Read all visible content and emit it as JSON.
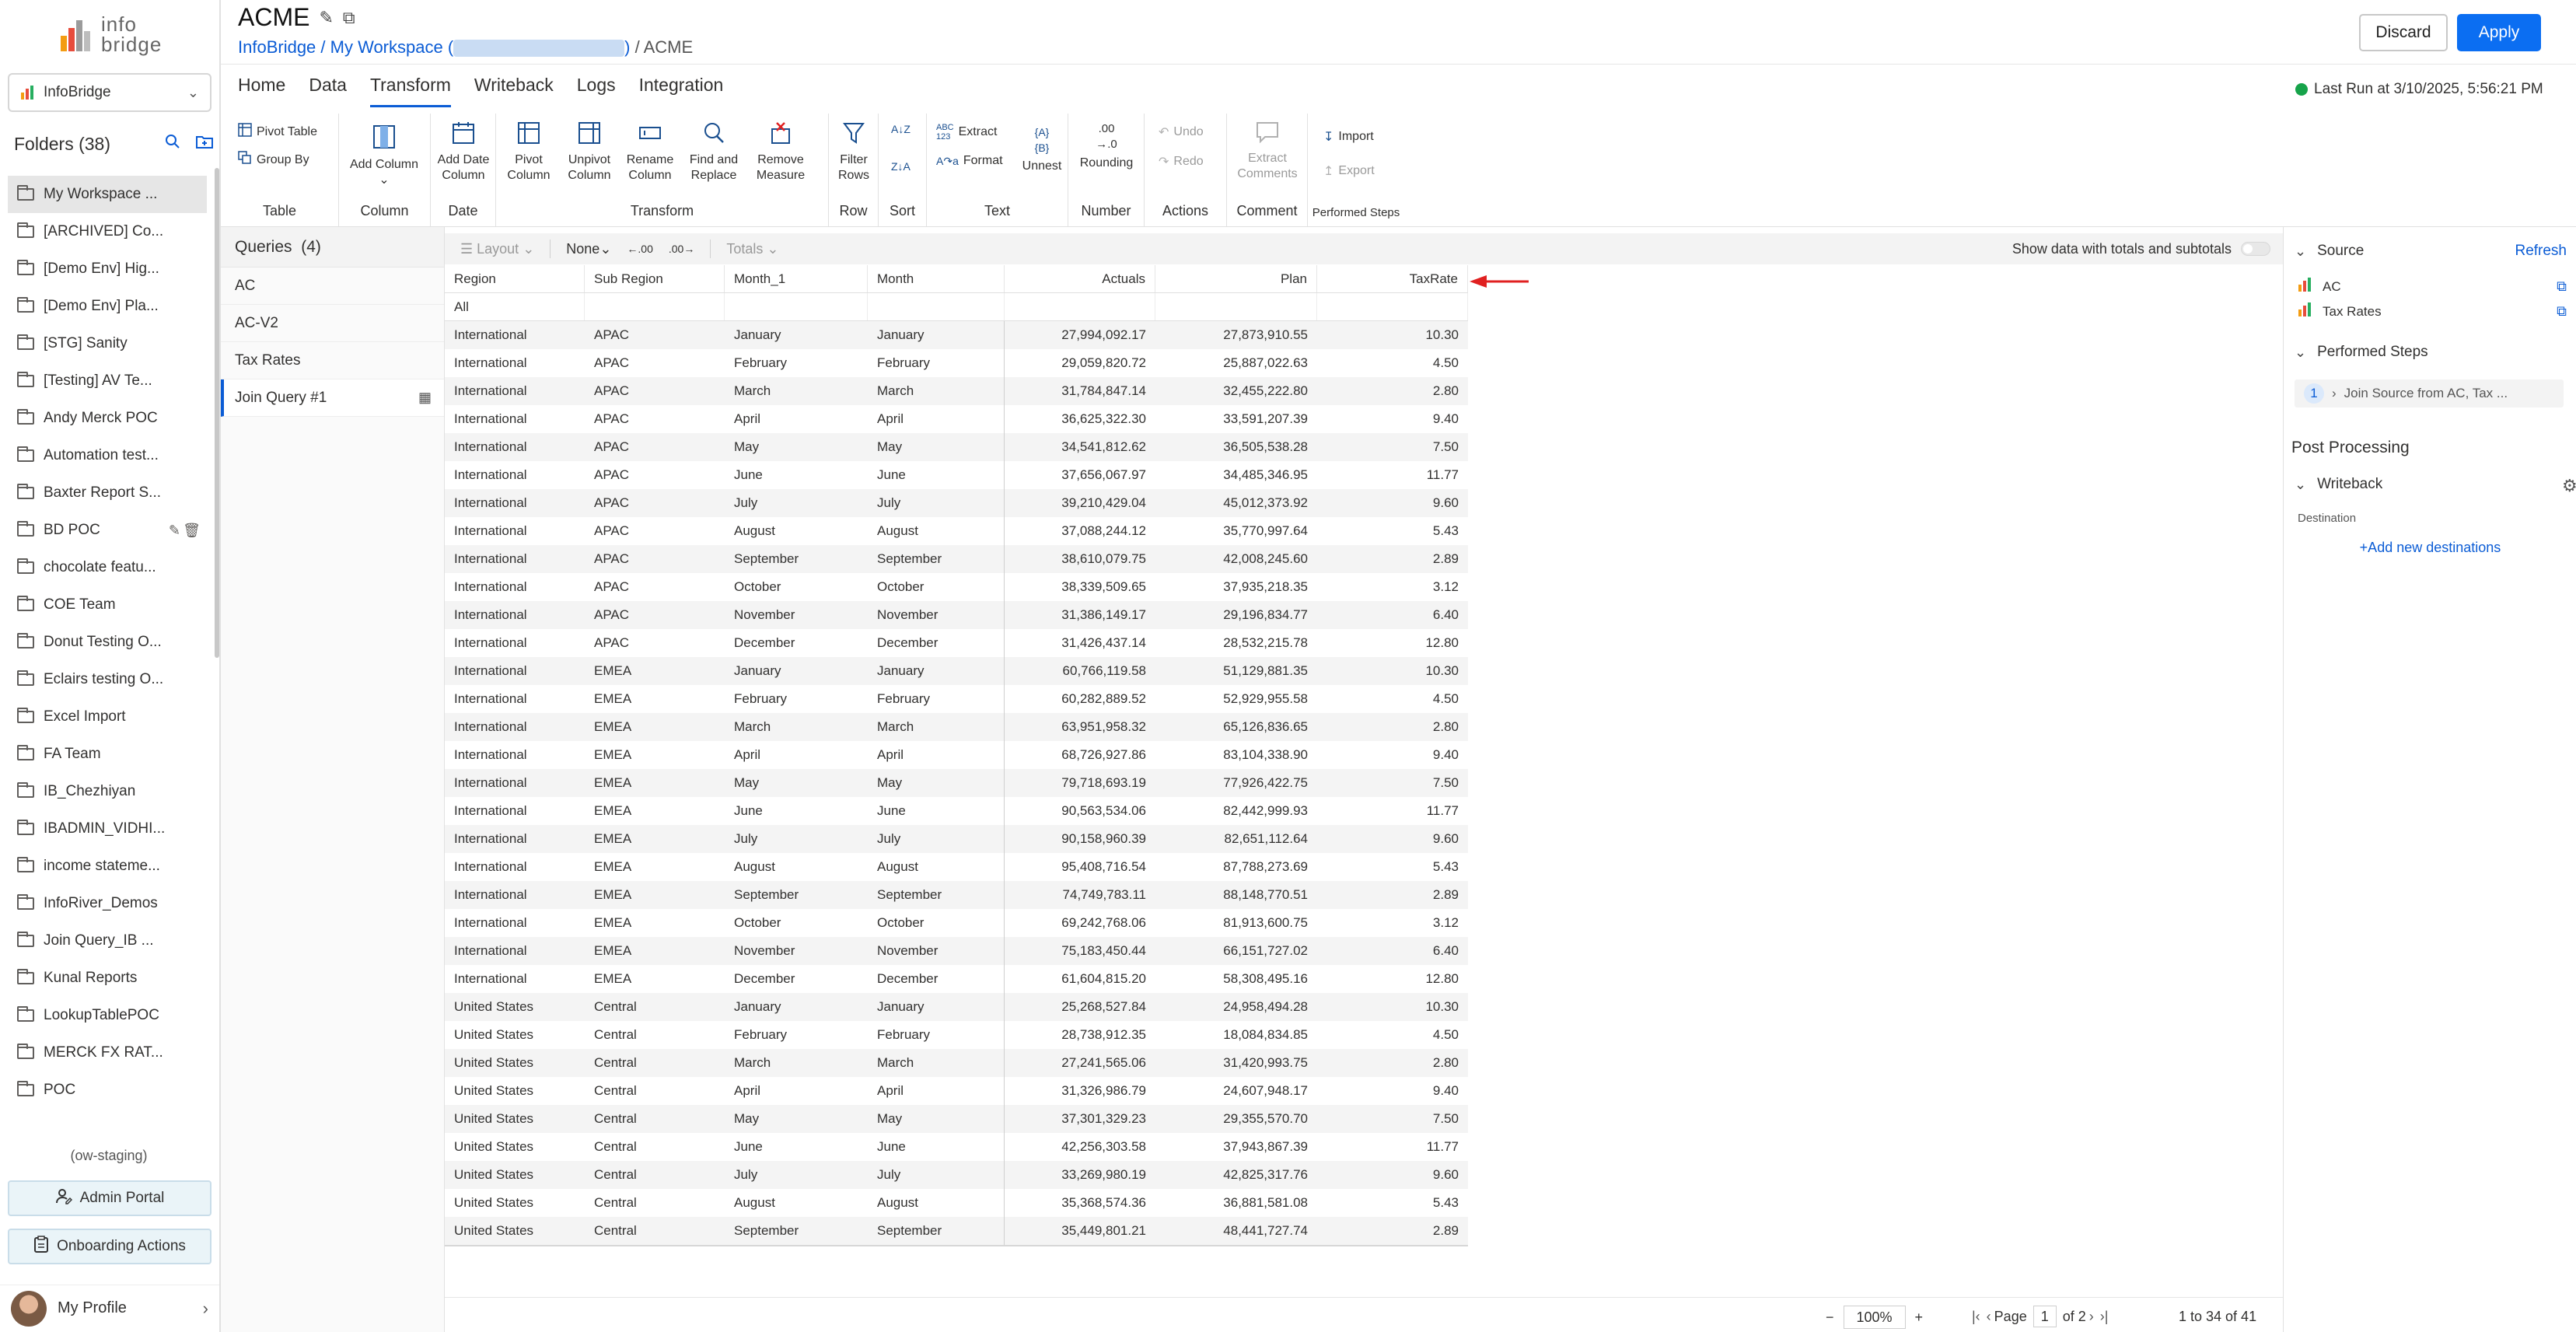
{
  "app": {
    "logo_line1": "info",
    "logo_line2": "bridge",
    "workspace_select": "InfoBridge",
    "folders_title": "Folders (38)",
    "env_label": "(ow-staging)",
    "admin_portal": "Admin Portal",
    "onboarding": "Onboarding Actions",
    "profile": "My Profile"
  },
  "folders": [
    "My Workspace ...",
    "[ARCHIVED] Co...",
    "[Demo Env] Hig...",
    "[Demo Env] Pla...",
    "[STG] Sanity",
    "[Testing] AV Te...",
    "Andy Merck POC",
    "Automation test...",
    "Baxter Report S...",
    "BD POC",
    "chocolate featu...",
    "COE Team",
    "Donut Testing O...",
    "Eclairs testing O...",
    "Excel Import",
    "FA Team",
    "IB_Chezhiyan",
    "IBADMIN_VIDHI...",
    "income stateme...",
    "InfoRiver_Demos",
    "Join Query_IB ...",
    "Kunal Reports",
    "LookupTablePOC",
    "MERCK FX RAT...",
    "POC"
  ],
  "header": {
    "title": "ACME",
    "crumb_root": "InfoBridge",
    "crumb_sep1": " / ",
    "crumb_ws": "My Workspace (",
    "crumb_ws_end": ")",
    "crumb_sep2": " / ",
    "crumb_last": "ACME",
    "discard": "Discard",
    "apply": "Apply",
    "last_run": "Last Run at 3/10/2025, 5:56:21 PM"
  },
  "nav_tabs": [
    "Home",
    "Data",
    "Transform",
    "Writeback",
    "Logs",
    "Integration"
  ],
  "ribbon": {
    "pivot_table": "Pivot Table",
    "group_by": "Group By",
    "g_table": "Table",
    "add_column": "Add Column",
    "g_column": "Column",
    "add_date_column_1": "Add Date",
    "add_date_column_2": "Column",
    "g_date": "Date",
    "pivot_column_1": "Pivot",
    "pivot_column_2": "Column",
    "unpivot_column_1": "Unpivot",
    "unpivot_column_2": "Column",
    "rename_column_1": "Rename",
    "rename_column_2": "Column",
    "find_replace_1": "Find and",
    "find_replace_2": "Replace",
    "remove_measure_1": "Remove",
    "remove_measure_2": "Measure",
    "g_transform": "Transform",
    "filter_rows_1": "Filter",
    "filter_rows_2": "Rows",
    "g_row": "Row",
    "g_sort": "Sort",
    "sort_az": "A↓Z",
    "sort_za": "Z↓A",
    "extract": "Extract",
    "format": "Format",
    "unnest": "Unnest",
    "g_text": "Text",
    "rounding": "Rounding",
    "g_number": "Number",
    "undo": "Undo",
    "redo": "Redo",
    "g_actions": "Actions",
    "extract_comments_1": "Extract",
    "extract_comments_2": "Comments",
    "g_comment": "Comment",
    "import": "Import",
    "export": "Export",
    "g_performed": "Performed Steps"
  },
  "queries": {
    "title": "Queries",
    "count": "(4)",
    "items": [
      "AC",
      "AC-V2",
      "Tax Rates",
      "Join Query #1"
    ]
  },
  "grid_toolbar": {
    "layout": "Layout",
    "none": "None",
    "dec_inc": ".00",
    "dec_dec": ".00",
    "totals": "Totals",
    "show_totals": "Show data with totals and subtotals"
  },
  "grid": {
    "columns": [
      "Region",
      "Sub Region",
      "Month_1",
      "Month",
      "Actuals",
      "Plan",
      "TaxRate"
    ],
    "all_label": "All",
    "rows": [
      [
        "International",
        "APAC",
        "January",
        "January",
        "27,994,092.17",
        "27,873,910.55",
        "10.30"
      ],
      [
        "International",
        "APAC",
        "February",
        "February",
        "29,059,820.72",
        "25,887,022.63",
        "4.50"
      ],
      [
        "International",
        "APAC",
        "March",
        "March",
        "31,784,847.14",
        "32,455,222.80",
        "2.80"
      ],
      [
        "International",
        "APAC",
        "April",
        "April",
        "36,625,322.30",
        "33,591,207.39",
        "9.40"
      ],
      [
        "International",
        "APAC",
        "May",
        "May",
        "34,541,812.62",
        "36,505,538.28",
        "7.50"
      ],
      [
        "International",
        "APAC",
        "June",
        "June",
        "37,656,067.97",
        "34,485,346.95",
        "11.77"
      ],
      [
        "International",
        "APAC",
        "July",
        "July",
        "39,210,429.04",
        "45,012,373.92",
        "9.60"
      ],
      [
        "International",
        "APAC",
        "August",
        "August",
        "37,088,244.12",
        "35,770,997.64",
        "5.43"
      ],
      [
        "International",
        "APAC",
        "September",
        "September",
        "38,610,079.75",
        "42,008,245.60",
        "2.89"
      ],
      [
        "International",
        "APAC",
        "October",
        "October",
        "38,339,509.65",
        "37,935,218.35",
        "3.12"
      ],
      [
        "International",
        "APAC",
        "November",
        "November",
        "31,386,149.17",
        "29,196,834.77",
        "6.40"
      ],
      [
        "International",
        "APAC",
        "December",
        "December",
        "31,426,437.14",
        "28,532,215.78",
        "12.80"
      ],
      [
        "International",
        "EMEA",
        "January",
        "January",
        "60,766,119.58",
        "51,129,881.35",
        "10.30"
      ],
      [
        "International",
        "EMEA",
        "February",
        "February",
        "60,282,889.52",
        "52,929,955.58",
        "4.50"
      ],
      [
        "International",
        "EMEA",
        "March",
        "March",
        "63,951,958.32",
        "65,126,836.65",
        "2.80"
      ],
      [
        "International",
        "EMEA",
        "April",
        "April",
        "68,726,927.86",
        "83,104,338.90",
        "9.40"
      ],
      [
        "International",
        "EMEA",
        "May",
        "May",
        "79,718,693.19",
        "77,926,422.75",
        "7.50"
      ],
      [
        "International",
        "EMEA",
        "June",
        "June",
        "90,563,534.06",
        "82,442,999.93",
        "11.77"
      ],
      [
        "International",
        "EMEA",
        "July",
        "July",
        "90,158,960.39",
        "82,651,112.64",
        "9.60"
      ],
      [
        "International",
        "EMEA",
        "August",
        "August",
        "95,408,716.54",
        "87,788,273.69",
        "5.43"
      ],
      [
        "International",
        "EMEA",
        "September",
        "September",
        "74,749,783.11",
        "88,148,770.51",
        "2.89"
      ],
      [
        "International",
        "EMEA",
        "October",
        "October",
        "69,242,768.06",
        "81,913,600.75",
        "3.12"
      ],
      [
        "International",
        "EMEA",
        "November",
        "November",
        "75,183,450.44",
        "66,151,727.02",
        "6.40"
      ],
      [
        "International",
        "EMEA",
        "December",
        "December",
        "61,604,815.20",
        "58,308,495.16",
        "12.80"
      ],
      [
        "United States",
        "Central",
        "January",
        "January",
        "25,268,527.84",
        "24,958,494.28",
        "10.30"
      ],
      [
        "United States",
        "Central",
        "February",
        "February",
        "28,738,912.35",
        "18,084,834.85",
        "4.50"
      ],
      [
        "United States",
        "Central",
        "March",
        "March",
        "27,241,565.06",
        "31,420,993.75",
        "2.80"
      ],
      [
        "United States",
        "Central",
        "April",
        "April",
        "31,326,986.79",
        "24,607,948.17",
        "9.40"
      ],
      [
        "United States",
        "Central",
        "May",
        "May",
        "37,301,329.23",
        "29,355,570.70",
        "7.50"
      ],
      [
        "United States",
        "Central",
        "June",
        "June",
        "42,256,303.58",
        "37,943,867.39",
        "11.77"
      ],
      [
        "United States",
        "Central",
        "July",
        "July",
        "33,269,980.19",
        "42,825,317.76",
        "9.60"
      ],
      [
        "United States",
        "Central",
        "August",
        "August",
        "35,368,574.36",
        "36,881,581.08",
        "5.43"
      ],
      [
        "United States",
        "Central",
        "September",
        "September",
        "35,449,801.21",
        "48,441,727.74",
        "2.89"
      ]
    ]
  },
  "footer": {
    "zoom": "100%",
    "page_label": "Page",
    "page_value": "1",
    "of_pages": "of 2",
    "count": "1 to 34 of 41"
  },
  "right_panel": {
    "source": "Source",
    "refresh": "Refresh",
    "sources": [
      "AC",
      "Tax Rates"
    ],
    "performed_steps": "Performed Steps",
    "step_num": "1",
    "step_text": "Join Source from AC, Tax ...",
    "post_processing": "Post Processing",
    "writeback": "Writeback",
    "destination": "Destination",
    "add_destination": "+Add new destinations"
  },
  "colors": {
    "accent": "#0b5cd5",
    "apply_bg": "#0b6ef2",
    "status_ok": "#16a34a",
    "arrow": "#e02020"
  }
}
